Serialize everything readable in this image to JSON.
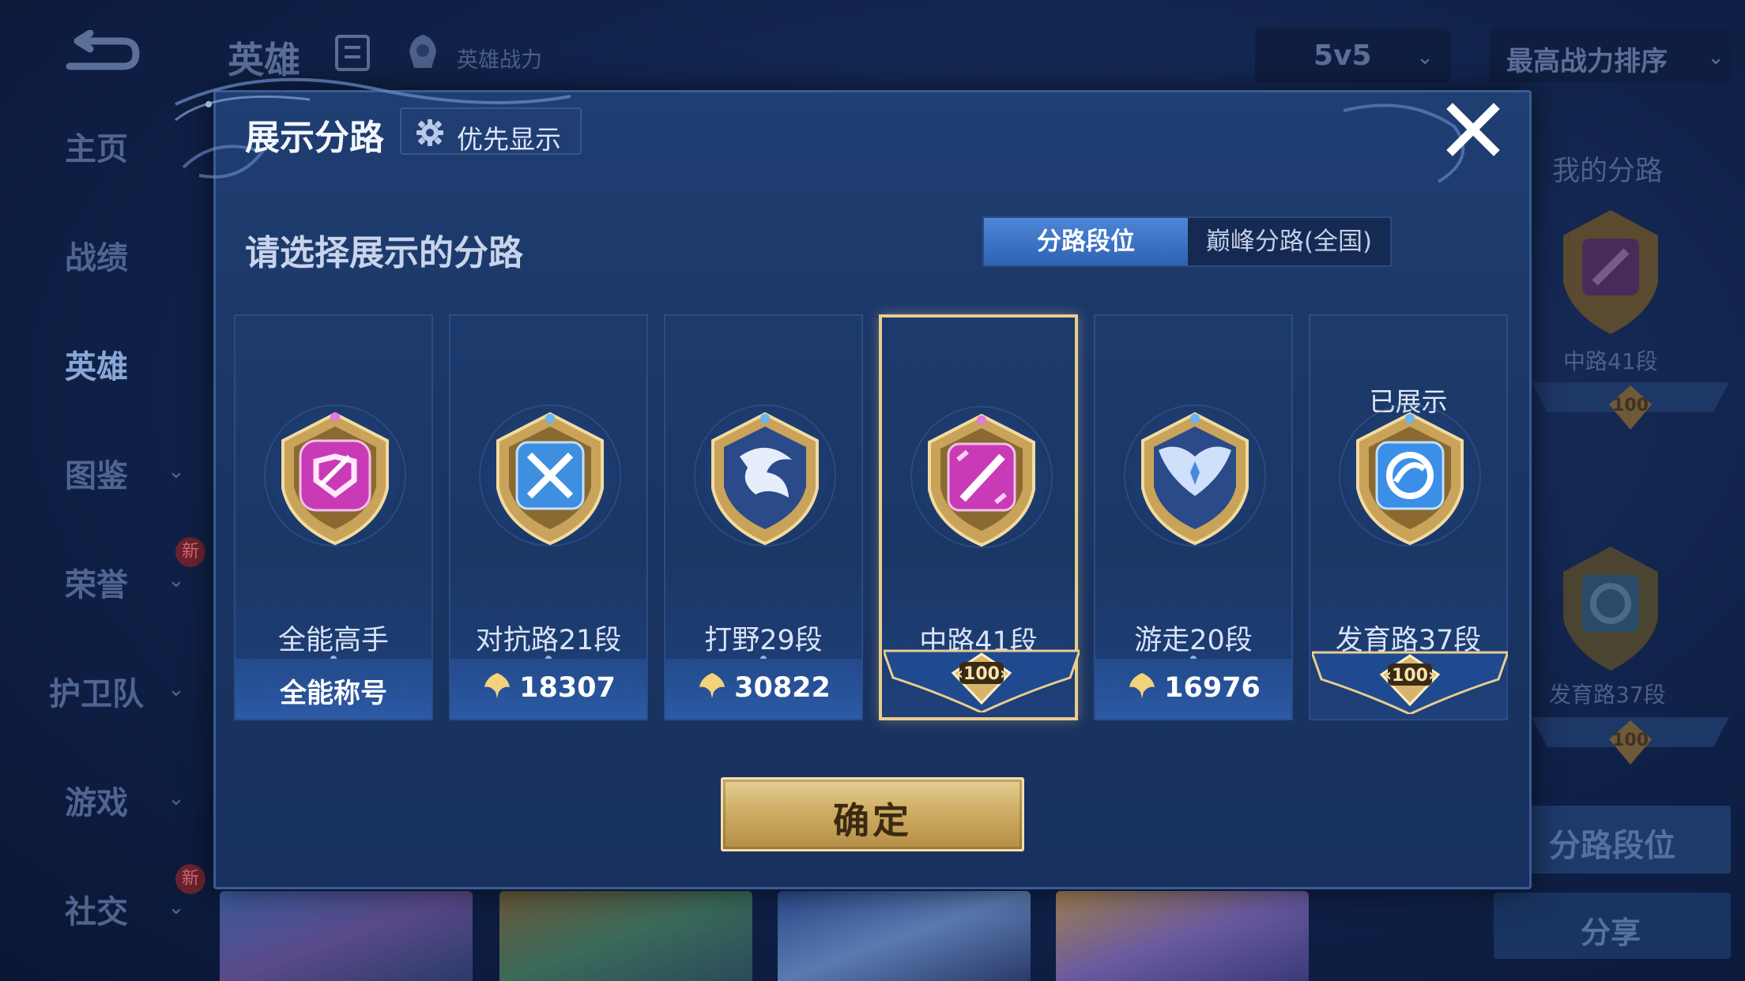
{
  "background": {
    "header": {
      "title": "英雄",
      "power_label": "英雄战力",
      "mode": "5v5",
      "sort": "最高战力排序"
    },
    "sidebar": [
      {
        "label": "主页",
        "chevron": "",
        "new": ""
      },
      {
        "label": "战绩",
        "chevron": "",
        "new": ""
      },
      {
        "label": "英雄",
        "chevron": "",
        "new": ""
      },
      {
        "label": "图鉴",
        "chevron": "⌄",
        "new": ""
      },
      {
        "label": "荣誉",
        "chevron": "⌄",
        "new": "新"
      },
      {
        "label": "护卫队",
        "chevron": "⌄",
        "new": ""
      },
      {
        "label": "游戏",
        "chevron": "⌄",
        "new": ""
      },
      {
        "label": "社交",
        "chevron": "⌄",
        "new": "新"
      }
    ],
    "right_panel": {
      "title": "我的分路",
      "lanes": [
        {
          "label": "中路41段",
          "plaque": "100"
        },
        {
          "label": "发育路37段",
          "plaque": "100"
        }
      ],
      "lane_button": "分路段位",
      "share_button": "分享"
    }
  },
  "modal": {
    "title": "展示分路",
    "priority_label": "优先显示",
    "close_icon": "close-icon",
    "prompt": "请选择展示的分路",
    "tabs": [
      {
        "label": "分路段位",
        "active": true
      },
      {
        "label": "巅峰分路(全国)",
        "active": false
      }
    ],
    "cards": [
      {
        "name": "全能高手",
        "sub": "全能称号",
        "score": "",
        "plaque": "",
        "shown": "",
        "selected": false,
        "color": "#c93bb6"
      },
      {
        "name": "对抗路21段",
        "sub": "",
        "score": "18307",
        "plaque": "",
        "shown": "",
        "selected": false,
        "color": "#3f8fe0"
      },
      {
        "name": "打野29段",
        "sub": "",
        "score": "30822",
        "plaque": "",
        "shown": "",
        "selected": false,
        "color": "#3a6fd0"
      },
      {
        "name": "中路41段",
        "sub": "",
        "score": "",
        "plaque": "100",
        "shown": "",
        "selected": true,
        "color": "#c93bb6"
      },
      {
        "name": "游走20段",
        "sub": "",
        "score": "16976",
        "plaque": "",
        "shown": "",
        "selected": false,
        "color": "#4a88e0"
      },
      {
        "name": "发育路37段",
        "sub": "",
        "score": "",
        "plaque": "100",
        "shown": "已展示",
        "selected": false,
        "color": "#3b8fe6"
      }
    ],
    "confirm_label": "确定"
  },
  "colors": {
    "gold": "#e9cd8e",
    "modal_bg": "#1b3666",
    "tab_active": "#3f74c6"
  }
}
